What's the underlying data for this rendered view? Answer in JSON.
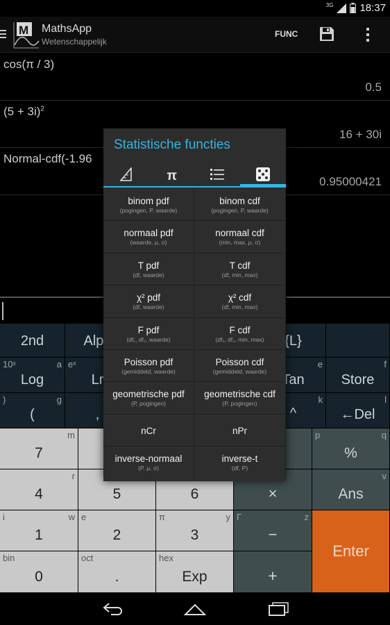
{
  "status": {
    "network": "3G",
    "time": "18:37"
  },
  "app": {
    "title": "MathsApp",
    "subtitle": "Wetenschappelijk",
    "func_label": "FUNC",
    "save_icon": "save-icon",
    "overflow_icon": "overflow-icon"
  },
  "history": [
    {
      "expr": "cos(π / 3)",
      "result": "0.5"
    },
    {
      "expr": "(5 + 3i)",
      "expr_sup": "2",
      "result": "16 + 30i"
    },
    {
      "expr": "Normal-cdf(-1.96",
      "result": "0.95000421"
    }
  ],
  "dialog": {
    "title": "Statistische functies",
    "tabs": [
      "triangle-ruler-icon",
      "pi-icon",
      "list-icon",
      "dice-icon"
    ],
    "active_tab": 3,
    "items": [
      {
        "name": "binom pdf",
        "args": "(pogingen, P, waarde)"
      },
      {
        "name": "binom cdf",
        "args": "(pogingen, P, waarde)"
      },
      {
        "name": "normaal pdf",
        "args": "(waarde, μ, σ)"
      },
      {
        "name": "normaal cdf",
        "args": "(min, max, μ, σ)"
      },
      {
        "name": "T pdf",
        "args": "(df, waarde)"
      },
      {
        "name": "T cdf",
        "args": "(df, min, max)"
      },
      {
        "name": "χ² pdf",
        "args": "(df, waarde)"
      },
      {
        "name": "χ² cdf",
        "args": "(df, min, max)"
      },
      {
        "name": "F pdf",
        "args": "(df₁, df₂, waarde)"
      },
      {
        "name": "F cdf",
        "args": "(df₁, df₂, min, max)"
      },
      {
        "name": "Poisson pdf",
        "args": "(gemiddeld, waarde)"
      },
      {
        "name": "Poisson cdf",
        "args": "(gemiddeld, waarde)"
      },
      {
        "name": "geometrische pdf",
        "args": "(P, pogingen)"
      },
      {
        "name": "geometrische cdf",
        "args": "(P, pogingen)"
      },
      {
        "name": "nCr",
        "args": ""
      },
      {
        "name": "nPr",
        "args": ""
      },
      {
        "name": "inverse-normaal",
        "args": "(P, μ, σ)"
      },
      {
        "name": "inverse-t",
        "args": "(df, P)"
      }
    ]
  },
  "keypad": {
    "row1": {
      "k2nd": "2nd",
      "alpha": "Alph",
      "list": "{L}"
    },
    "row2": {
      "log": "Log",
      "log_sub_l": "10ˣ",
      "log_sub_r": "a",
      "ln": "Lr",
      "ln_sub_l": "eˣ",
      "tan": "Tan",
      "tan_sub_r": "e",
      "store": "Store",
      "store_sub_r": "f"
    },
    "row3": {
      "paren": "(",
      "paren_sub_l": ")",
      "paren_sub_r": "g",
      "comma": ",",
      "pow": "^",
      "pow_sub_r": "k",
      "del": "←Del",
      "del_sub_r": "l"
    },
    "row4": {
      "k7": "7",
      "k7_sub": "m",
      "pct": "%",
      "pct_sub_l": "p",
      "pct_sub_r": "q"
    },
    "row5": {
      "k4": "4",
      "k4_sub": "r",
      "k5": "5",
      "k6": "6",
      "mul": "×",
      "ans": "Ans",
      "ans_sub": "v"
    },
    "row6": {
      "k1": "1",
      "k1_sub_l": "i",
      "k1_sub_r": "w",
      "k2": "2",
      "k2_sub": "e",
      "k3": "3",
      "k3_sub_l": "π",
      "k3_sub_r": "y",
      "minus": "−",
      "minus_sub_l": "Γ",
      "minus_sub_r": "z",
      "enter": "Enter"
    },
    "row7": {
      "k0": "0",
      "k0_sub": "bin",
      "dot": ".",
      "dot_sub": "oct",
      "exp": "Exp",
      "exp_sub": "hex",
      "plus": "+"
    }
  },
  "nav": {
    "back": "back-icon",
    "home": "home-icon",
    "recents": "recents-icon"
  }
}
